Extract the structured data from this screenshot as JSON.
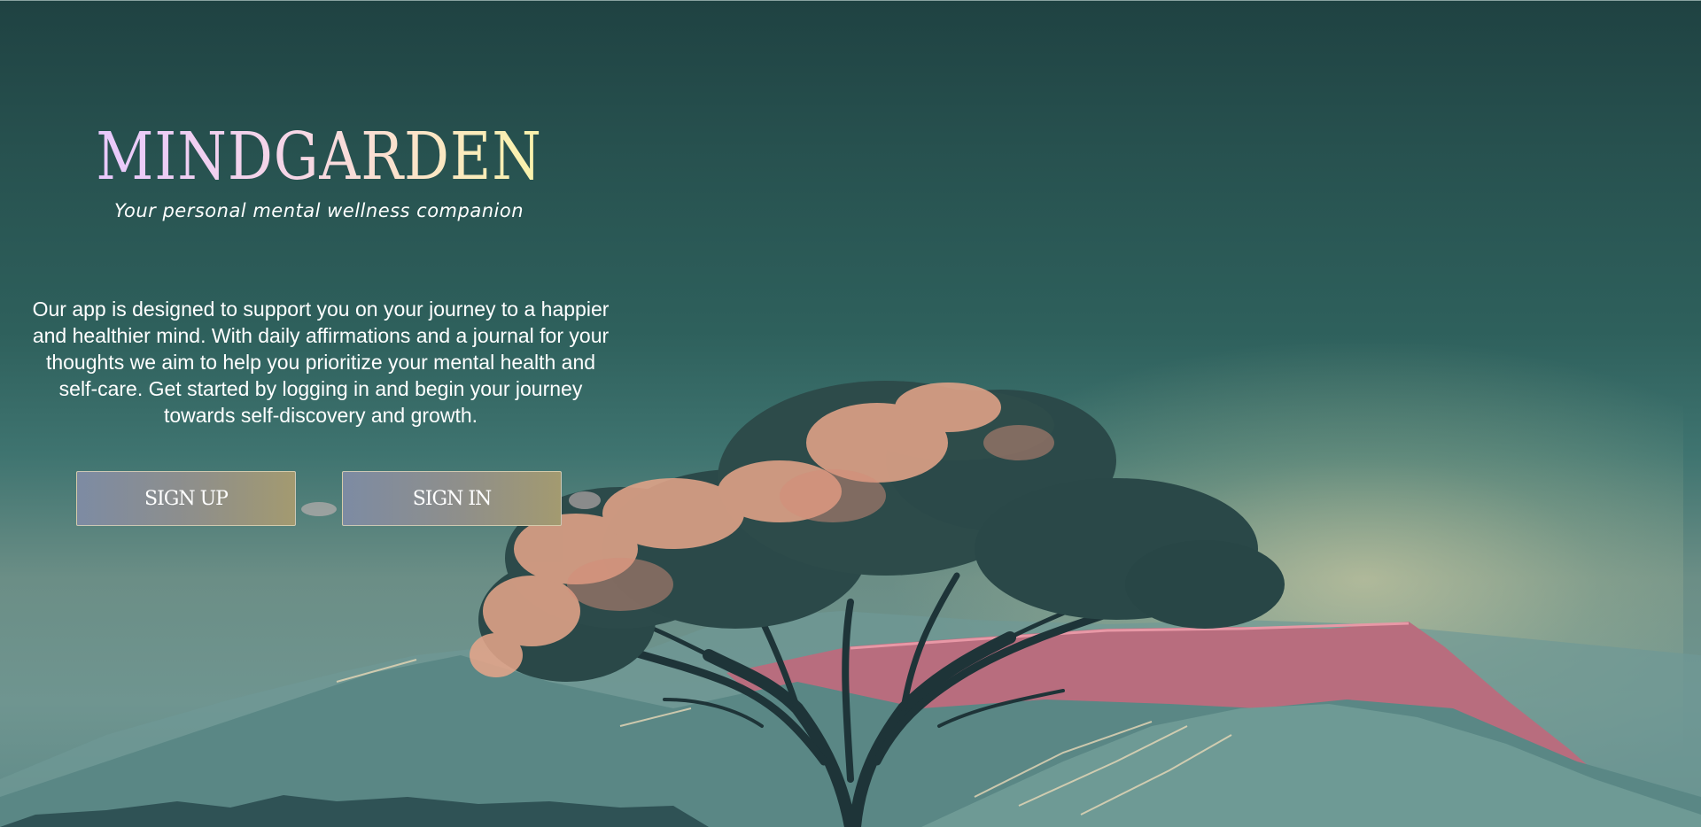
{
  "brand": {
    "logo": "MINDGARDEN",
    "tagline": "Your personal mental wellness companion"
  },
  "intro": {
    "text": "Our app is designed to support you on your journey to a happier and healthier mind. With daily affirmations and a journal for your thoughts we aim to help you prioritize your mental health and self-care. Get started by logging in and begin your journey towards self-discovery and growth."
  },
  "actions": {
    "signup_label": "SIGN UP",
    "signin_label": "SIGN IN"
  },
  "colors": {
    "background_top": "#1f4242",
    "background_mid": "#2e605c",
    "logo_gradient_start": "#e7c7ff",
    "logo_gradient_end": "#f9f6a6",
    "button_gradient_start": "#7d8ba3",
    "button_gradient_end": "#a39a70",
    "mountain_pink": "#c9798a",
    "tree_foliage": "#2c4a4a",
    "tree_highlight": "#e8a68a"
  },
  "background": {
    "illustration": "tree-on-mountains-illustration"
  }
}
